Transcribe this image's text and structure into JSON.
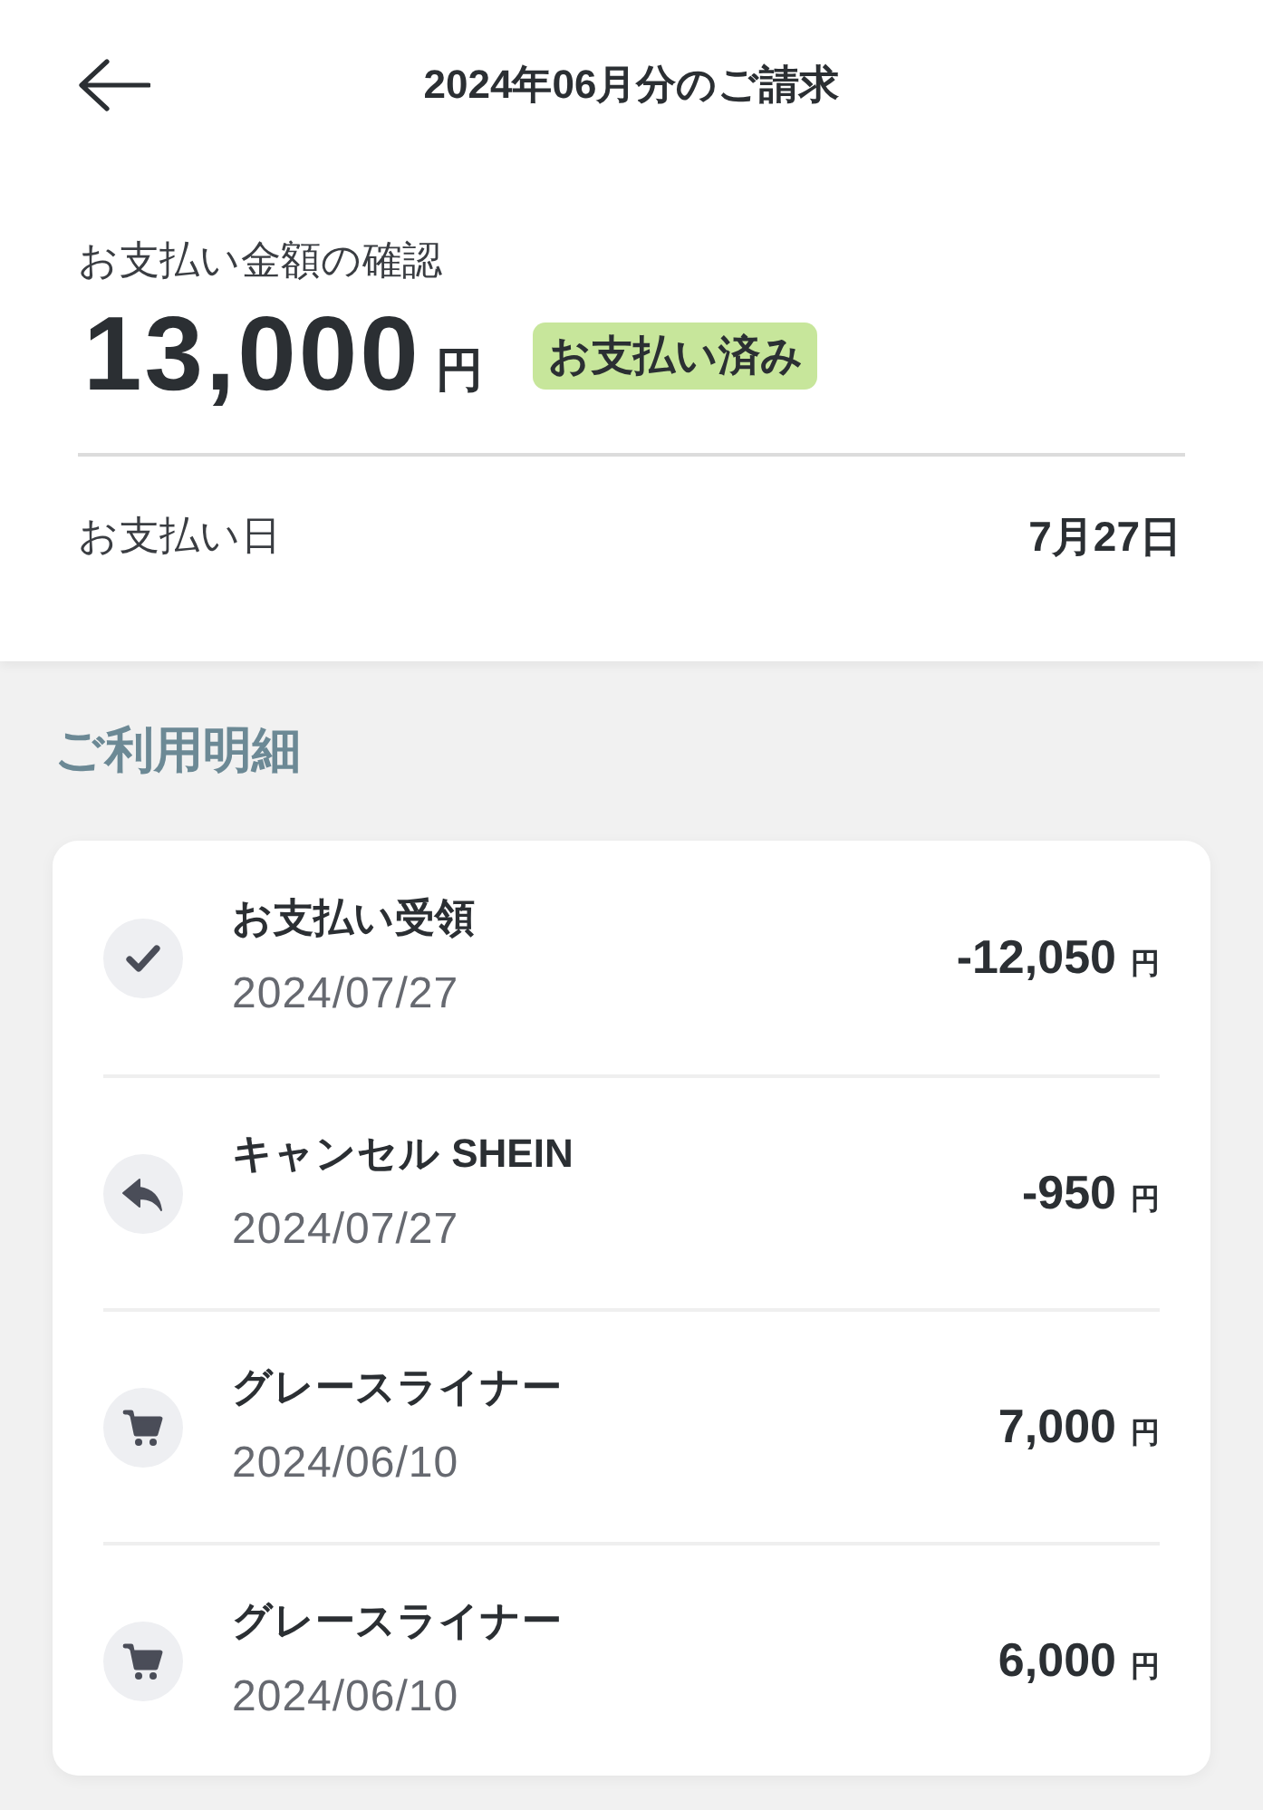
{
  "header": {
    "title": "2024年06月分のご請求"
  },
  "summary": {
    "label": "お支払い金額の確認",
    "amount": "13,000",
    "currency": "円",
    "status_badge": "お支払い済み",
    "payment_date": {
      "label": "お支払い日",
      "value": "7月27日"
    }
  },
  "details": {
    "heading": "ご利用明細",
    "items": [
      {
        "kind": "payment",
        "title": "お支払い受領",
        "date": "2024/07/27",
        "amount": "-12,050",
        "currency": "円"
      },
      {
        "kind": "cancel",
        "title": "キャンセル SHEIN",
        "date": "2024/07/27",
        "amount": "-950",
        "currency": "円"
      },
      {
        "kind": "purchase",
        "title": "グレースライナー",
        "date": "2024/06/10",
        "amount": "7,000",
        "currency": "円"
      },
      {
        "kind": "purchase",
        "title": "グレースライナー",
        "date": "2024/06/10",
        "amount": "6,000",
        "currency": "円"
      }
    ]
  }
}
